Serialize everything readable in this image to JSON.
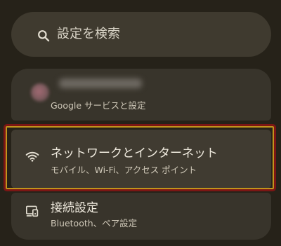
{
  "search": {
    "placeholder": "設定を検索",
    "icon": "search-icon"
  },
  "settings": {
    "account": {
      "subtitle": "Google サービスと設定",
      "icon": "avatar"
    },
    "network": {
      "title": "ネットワークとインターネット",
      "subtitle": "モバイル、Wi‑Fi、アクセス ポイント",
      "icon": "wifi-icon"
    },
    "connected_devices": {
      "title": "接続設定",
      "subtitle": "Bluetooth、ペア設定",
      "icon": "devices-icon"
    }
  },
  "colors": {
    "background": "#262219",
    "card": "#38342b",
    "highlight_border": "#c1941c"
  }
}
